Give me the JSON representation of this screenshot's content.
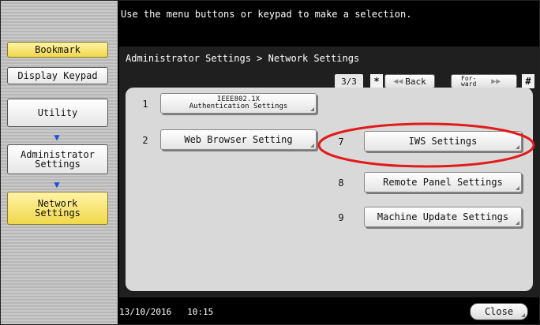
{
  "top_message": "Use the menu buttons or keypad to make a selection.",
  "sidebar": {
    "bookmark": "Bookmark",
    "display_keypad": "Display Keypad",
    "utility": "Utility",
    "admin_settings": "Administrator\nSettings",
    "network_settings": "Network\nSettings"
  },
  "breadcrumb": "Administrator Settings > Network Settings",
  "pager": {
    "page": "3/3",
    "star": "*",
    "back_label": "Back",
    "forward_label": "For-\nward",
    "hash": "#"
  },
  "options": [
    {
      "num": "1",
      "label": "IEEE802.1X\nAuthentication Settings"
    },
    {
      "num": "2",
      "label": "Web Browser Setting"
    },
    {
      "num": "7",
      "label": "IWS Settings"
    },
    {
      "num": "8",
      "label": "Remote Panel Settings"
    },
    {
      "num": "9",
      "label": "Machine Update Settings"
    }
  ],
  "status": {
    "date": "13/10/2016",
    "time": "10:15"
  },
  "close_label": "Close",
  "colors": {
    "highlight": "#e21a1a",
    "arrow": "#1d4fd8",
    "selected_button": "#f1d84a"
  },
  "icons": [
    "arrow-down-icon",
    "back-chevron-icon",
    "forward-chevron-icon"
  ]
}
